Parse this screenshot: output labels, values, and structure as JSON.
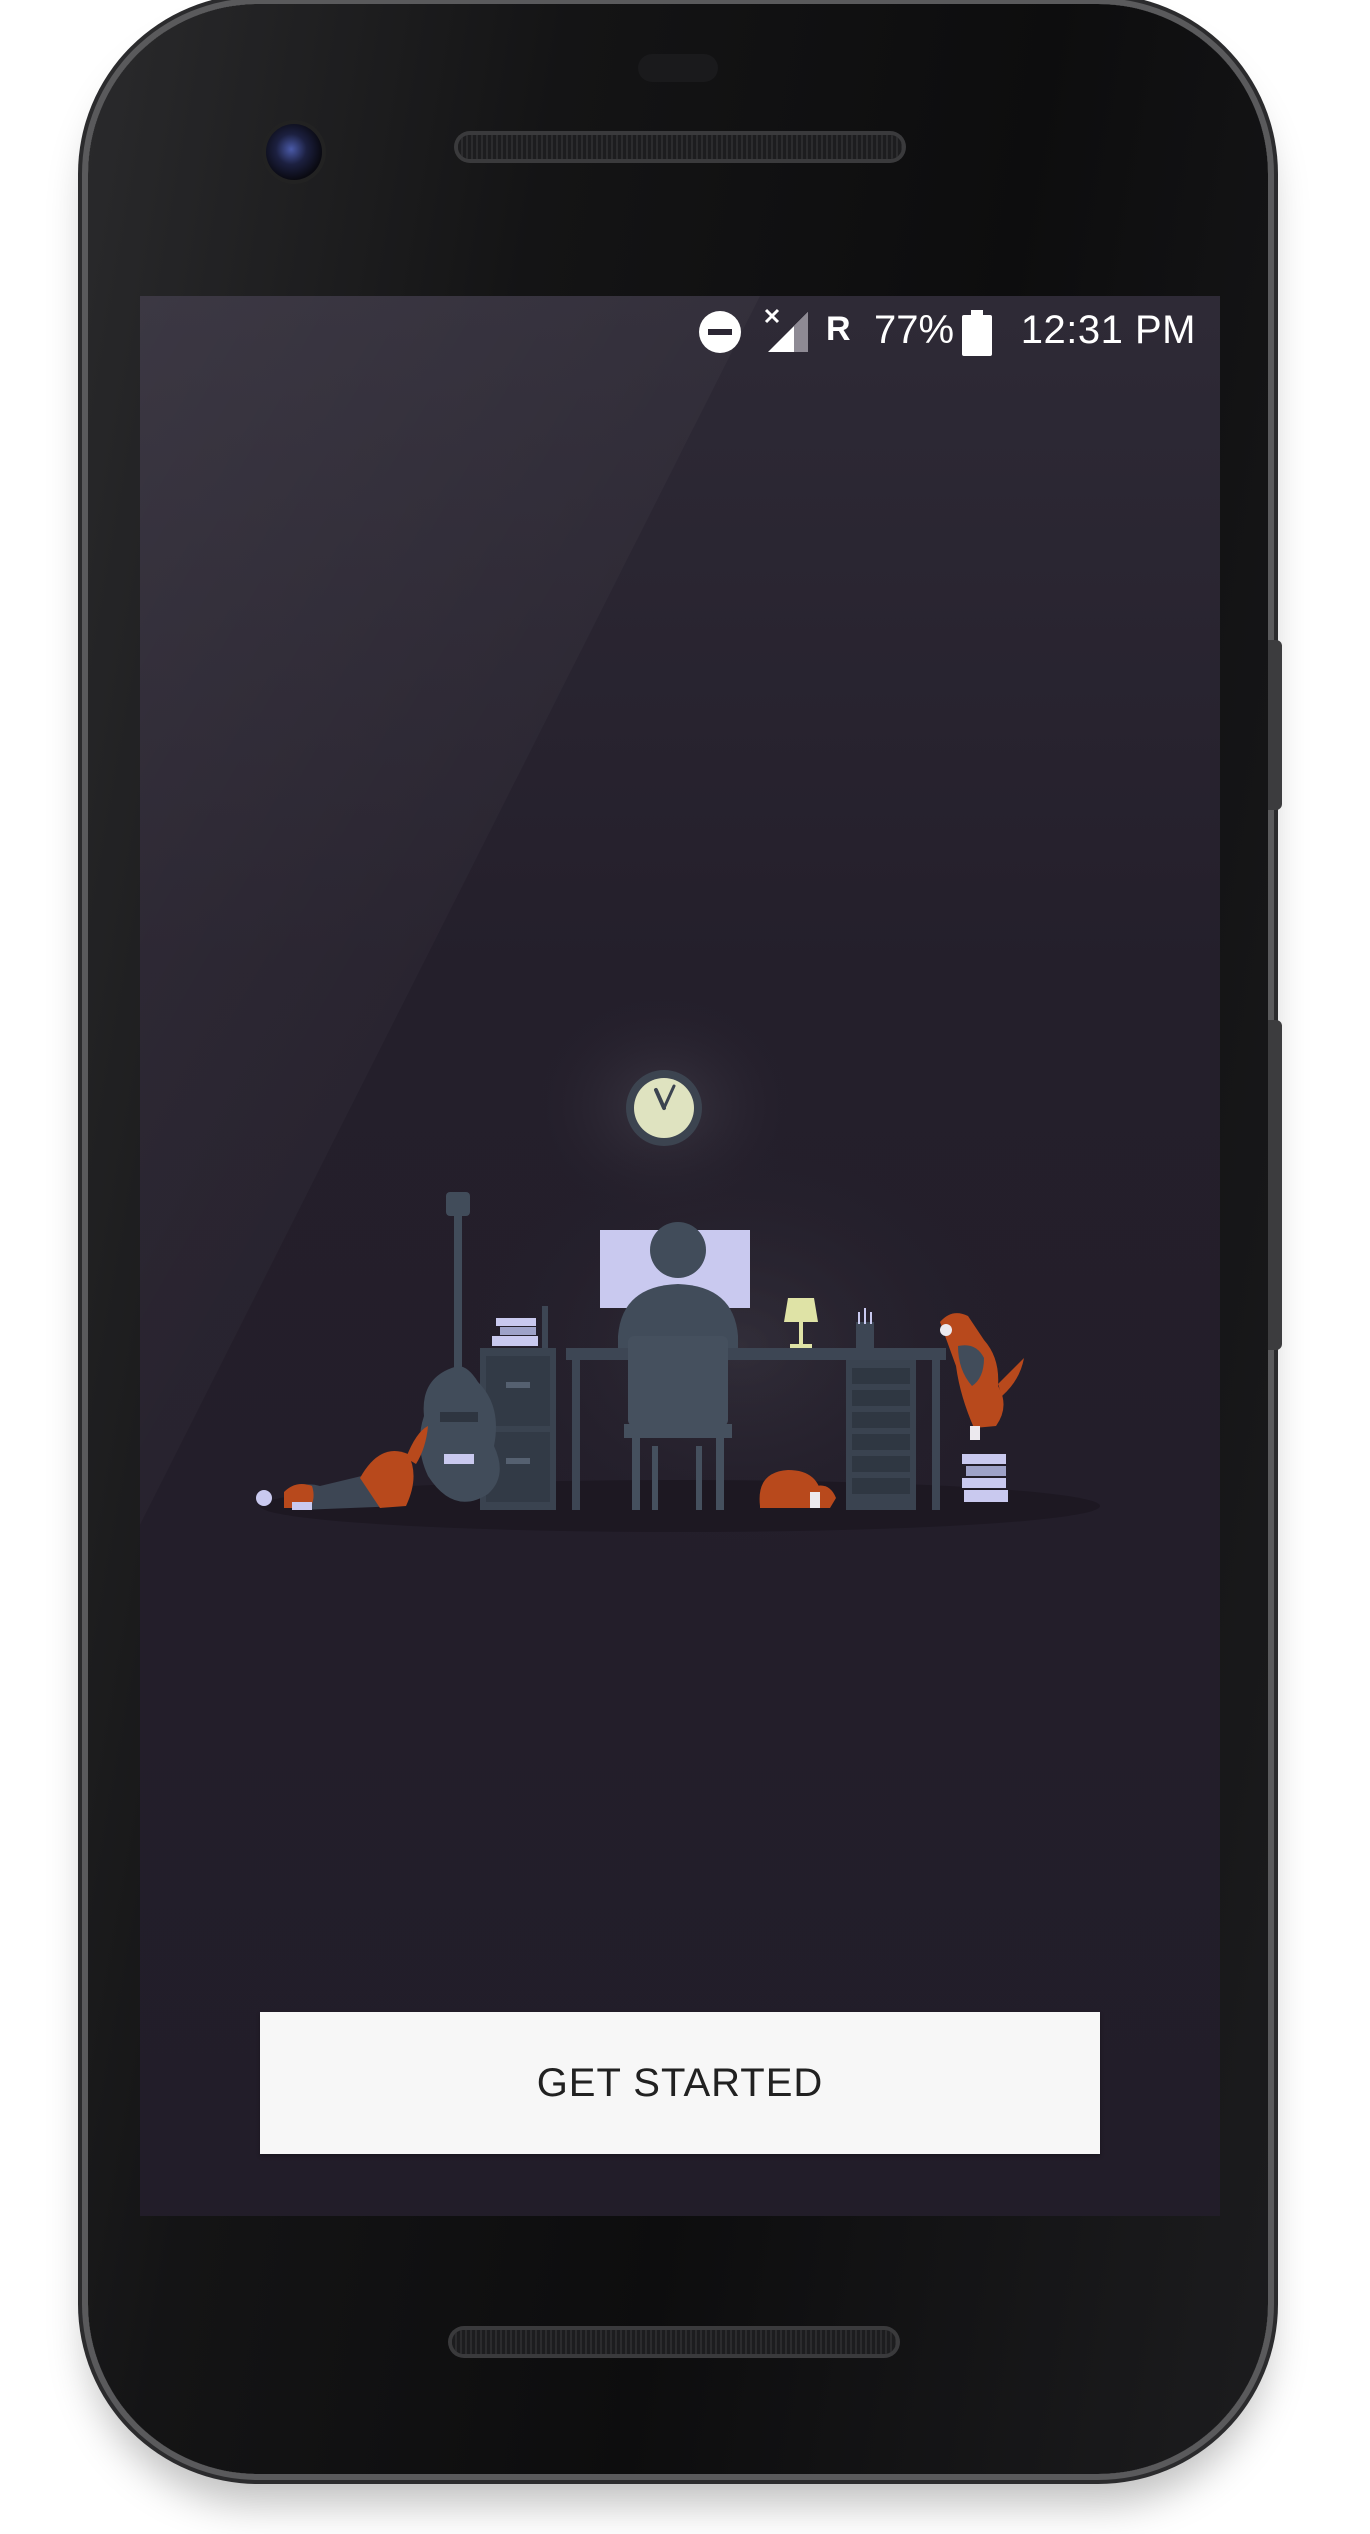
{
  "status_bar": {
    "roaming_indicator": "R",
    "battery_percent": "77%",
    "time": "12:31 PM",
    "icons": [
      "do-not-disturb-icon",
      "no-signal-icon",
      "battery-icon"
    ]
  },
  "onboarding": {
    "illustration": "person-at-desk-with-dogs-illustration",
    "cta_label": "GET STARTED"
  },
  "colors": {
    "screen_background": "#241f2b",
    "button_background": "#f7f7f7",
    "button_text": "#212121",
    "dog_orange": "#b8491c",
    "monitor_glow": "#c9c9ef"
  }
}
